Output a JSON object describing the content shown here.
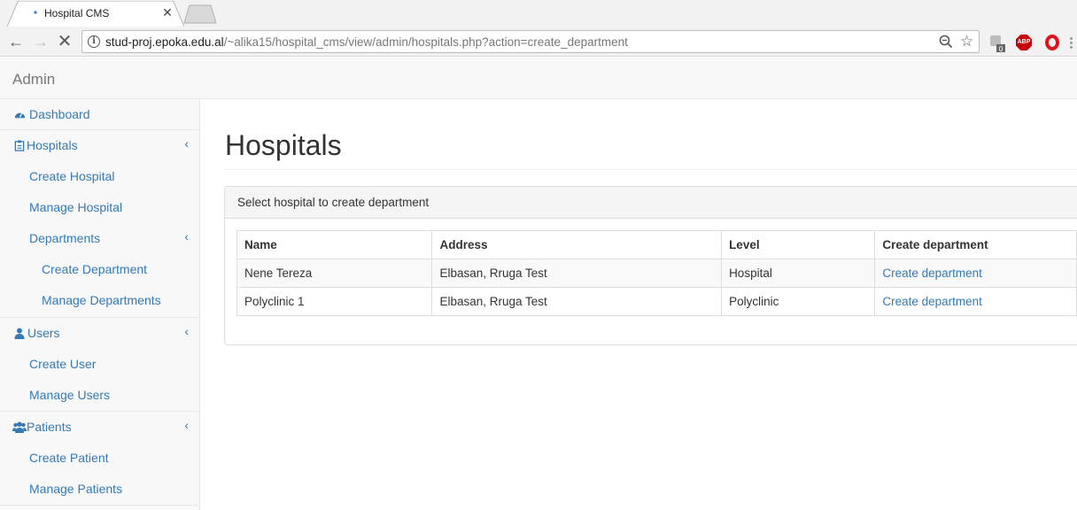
{
  "browser": {
    "tab_title": "Hospital CMS",
    "url_host": "stud-proj.epoka.edu.al",
    "url_path": "/~alika15/hospital_cms/view/admin/hospitals.php?action=create_department",
    "ext_badge": "0",
    "abp_label": "ABP"
  },
  "header": {
    "brand": "Admin"
  },
  "sidebar": {
    "dashboard": "Dashboard",
    "hospitals": "Hospitals",
    "create_hospital": "Create Hospital",
    "manage_hospital": "Manage Hospital",
    "departments": "Departments",
    "create_department": "Create Department",
    "manage_departments": "Manage Departments",
    "users": "Users",
    "create_user": "Create User",
    "manage_users": "Manage Users",
    "patients": "Patients",
    "create_patient": "Create Patient",
    "manage_patients": "Manage Patients"
  },
  "main": {
    "title": "Hospitals",
    "panel_heading": "Select hospital to create department",
    "columns": [
      "Name",
      "Address",
      "Level",
      "Create department"
    ],
    "rows": [
      {
        "name": "Nene Tereza",
        "address": "Elbasan, Rruga Test",
        "level": "Hospital",
        "action": "Create department"
      },
      {
        "name": "Polyclinic 1",
        "address": "Elbasan, Rruga Test",
        "level": "Polyclinic",
        "action": "Create department"
      }
    ]
  },
  "colors": {
    "link": "#337ab7",
    "sidebar_bg": "#f8f8f8",
    "border": "#ddd"
  }
}
